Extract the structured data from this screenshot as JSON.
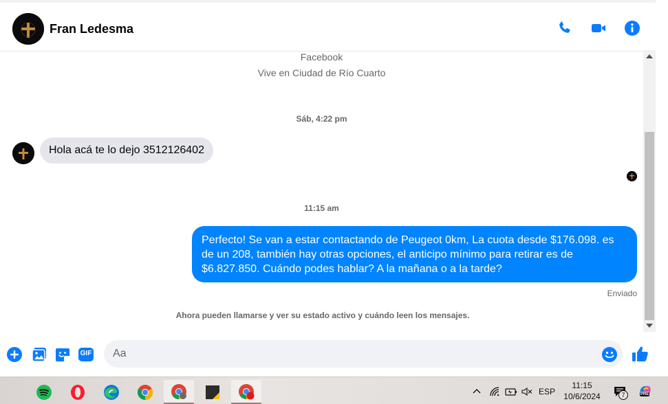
{
  "header": {
    "contact_name": "Fran Ledesma",
    "actions": [
      {
        "name": "phone-call-icon"
      },
      {
        "name": "video-call-icon"
      },
      {
        "name": "conversation-info-icon"
      }
    ],
    "accent": "#0a7cff"
  },
  "profile_info": {
    "line1": "Facebook",
    "line2": "Vive en Ciudad de Río Cuarto"
  },
  "messages": {
    "ts1": "Sáb, 4:22 pm",
    "incoming_1": "Hola acá te lo dejo 3512126402",
    "ts2": "11:15 am",
    "outgoing_1": "Perfecto!  Se van a estar contactando de Peugeot 0km, La cuota desde $176.098. es de un 208, también hay otras opciones, el anticipo mínimo para retirar es de $6.827.850. Cuándo podes hablar? A la mañana o a la tarde?",
    "status": "Enviado",
    "notice": "Ahora pueden llamarse y ver su estado activo y cuándo leen los mensajes.",
    "outgoing_color": "#0084ff",
    "incoming_color": "#e4e6eb"
  },
  "composer": {
    "placeholder": "Aa",
    "buttons": [
      "add-icon",
      "photo-icon",
      "sticker-icon",
      "gif-icon",
      "emoji-icon",
      "like-icon"
    ],
    "gif_label": "GIF"
  },
  "taskbar": {
    "apps": [
      "spotify-icon",
      "opera-icon",
      "edge-icon",
      "chrome-icon",
      "chrome-profile-icon",
      "sticky-notes-icon",
      "chrome-red-icon"
    ],
    "language": "ESP",
    "time": "11:15",
    "date": "10/6/2024",
    "notification_count": "7",
    "copilot_badge": "PRE"
  }
}
